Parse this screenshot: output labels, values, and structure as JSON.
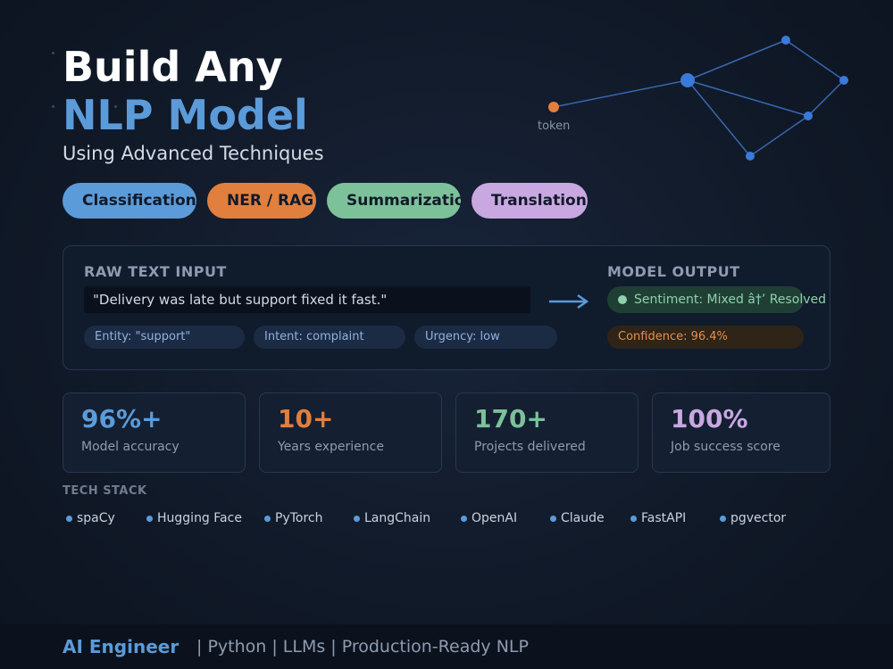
{
  "hero": {
    "title_line1": "Build Any",
    "title_line2": "NLP Model",
    "subtitle": "Using Advanced Techniques"
  },
  "graph": {
    "token_label": "token",
    "colors": {
      "token_node": "#e07f3e",
      "nodes": "#3a7ad9",
      "edges": "#3867b0"
    }
  },
  "pills": [
    {
      "label": "Classification",
      "color": "#5b9bd9"
    },
    {
      "label": "NER / RAG",
      "color": "#e07f3e"
    },
    {
      "label": "Summarization",
      "color": "#7cc19a"
    },
    {
      "label": "Translation",
      "color": "#c9a7e1"
    }
  ],
  "demo": {
    "input_label": "RAW TEXT INPUT",
    "input_text": "\"Delivery was late but support fixed it fast.\"",
    "chips": [
      {
        "label": "Entity: \"support\""
      },
      {
        "label": "Intent: complaint"
      },
      {
        "label": "Urgency: low"
      }
    ],
    "output_label": "MODEL OUTPUT",
    "sentiment": "Sentiment: Mixed â†’ Resolved",
    "confidence": "Confidence: 96.4%"
  },
  "stats": [
    {
      "value": "96%+",
      "label": "Model accuracy",
      "color": "#5b9bd9"
    },
    {
      "value": "10+",
      "label": "Years experience",
      "color": "#e07f3e"
    },
    {
      "value": "170+",
      "label": "Projects delivered",
      "color": "#7cc19a"
    },
    {
      "value": "100%",
      "label": "Job success score",
      "color": "#c9a7e1"
    }
  ],
  "tech_stack": {
    "title": "TECH STACK",
    "items": [
      "spaCy",
      "Hugging Face",
      "PyTorch",
      "LangChain",
      "OpenAI",
      "Claude",
      "FastAPI",
      "pgvector"
    ]
  },
  "footer": {
    "brand": "AI Engineer",
    "tagline": "| Python | LLMs | Production-Ready NLP"
  }
}
